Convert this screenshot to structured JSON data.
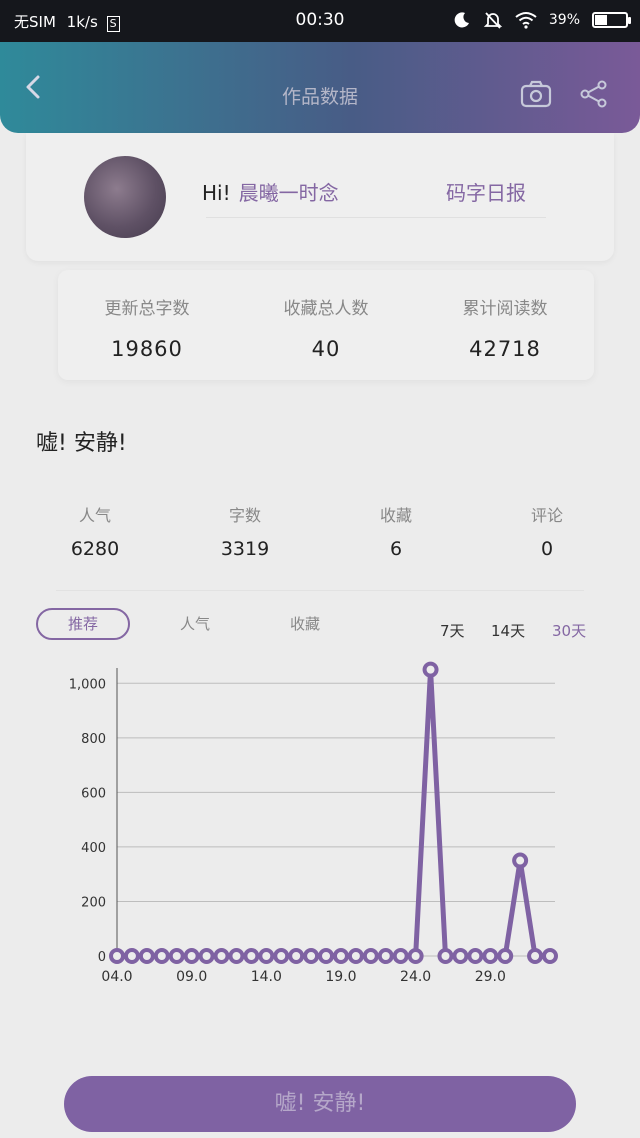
{
  "status_bar": {
    "carrier": "无SIM",
    "speed": "1k/s",
    "s_badge": "S",
    "time": "00:30",
    "battery": "39%",
    "battery_level": 0.39,
    "icons": [
      "moon-icon",
      "mute-bell-icon",
      "wifi-icon",
      "battery-icon"
    ]
  },
  "header": {
    "title": "作品数据",
    "back_icon": "chevron-left-icon",
    "camera_icon": "camera-icon",
    "share_icon": "share-icon"
  },
  "profile": {
    "greeting": "Hi!",
    "name": "晨曦一时念",
    "report_label": "码字日报"
  },
  "totals": [
    {
      "label": "更新总字数",
      "value": "19860"
    },
    {
      "label": "收藏总人数",
      "value": "40"
    },
    {
      "label": "累计阅读数",
      "value": "42718"
    }
  ],
  "work": {
    "title": "嘘! 安静!",
    "stats": [
      {
        "label": "人气",
        "value": "6280"
      },
      {
        "label": "字数",
        "value": "3319"
      },
      {
        "label": "收藏",
        "value": "6"
      },
      {
        "label": "评论",
        "value": "0"
      }
    ]
  },
  "tabs": [
    "推荐",
    "人气",
    "收藏"
  ],
  "active_tab": 0,
  "ranges": [
    "7天",
    "14天",
    "30天"
  ],
  "active_range": 2,
  "chart_data": {
    "type": "line",
    "x_tick_labels": [
      "04.0",
      "09.0",
      "14.0",
      "19.0",
      "24.0",
      "29.0"
    ],
    "x": [
      1,
      2,
      3,
      4,
      5,
      6,
      7,
      8,
      9,
      10,
      11,
      12,
      13,
      14,
      15,
      16,
      17,
      18,
      19,
      20,
      21,
      22,
      23,
      24,
      25,
      26,
      27,
      28,
      29,
      30
    ],
    "y": [
      0,
      0,
      0,
      0,
      0,
      0,
      0,
      0,
      0,
      0,
      0,
      0,
      0,
      0,
      0,
      0,
      0,
      0,
      0,
      0,
      0,
      1050,
      0,
      0,
      0,
      0,
      0,
      350,
      0,
      0
    ],
    "yticks": [
      0,
      200,
      400,
      600,
      800,
      1000
    ],
    "ytick_labels": [
      "0",
      "200",
      "400",
      "600",
      "800",
      "1,000"
    ],
    "ylim": [
      0,
      1100
    ],
    "grid": "horizontal",
    "color": "#7f62a3"
  },
  "bottom_button": "嘘! 安静!",
  "colors": {
    "accent": "#8467a3",
    "header_start": "#2f8a9a",
    "header_end": "#7a5a98"
  }
}
